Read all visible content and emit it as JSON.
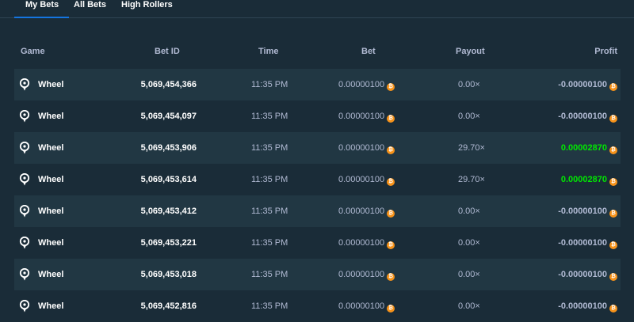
{
  "tabs": {
    "my_bets": "My Bets",
    "all_bets": "All Bets",
    "high_rollers": "High Rollers"
  },
  "columns": {
    "game": "Game",
    "bet_id": "Bet ID",
    "time": "Time",
    "bet": "Bet",
    "payout": "Payout",
    "profit": "Profit"
  },
  "colors": {
    "background": "#1a2c38",
    "row_alt": "#213743",
    "active_tab": "#1475e1",
    "win": "#00e701",
    "coin": "#f7931a"
  },
  "rows": [
    {
      "game": "Wheel",
      "bet_id": "5,069,454,366",
      "time": "11:35 PM",
      "bet": "0.00000100",
      "payout": "0.00×",
      "profit": "-0.00000100",
      "win": false
    },
    {
      "game": "Wheel",
      "bet_id": "5,069,454,097",
      "time": "11:35 PM",
      "bet": "0.00000100",
      "payout": "0.00×",
      "profit": "-0.00000100",
      "win": false
    },
    {
      "game": "Wheel",
      "bet_id": "5,069,453,906",
      "time": "11:35 PM",
      "bet": "0.00000100",
      "payout": "29.70×",
      "profit": "0.00002870",
      "win": true
    },
    {
      "game": "Wheel",
      "bet_id": "5,069,453,614",
      "time": "11:35 PM",
      "bet": "0.00000100",
      "payout": "29.70×",
      "profit": "0.00002870",
      "win": true
    },
    {
      "game": "Wheel",
      "bet_id": "5,069,453,412",
      "time": "11:35 PM",
      "bet": "0.00000100",
      "payout": "0.00×",
      "profit": "-0.00000100",
      "win": false
    },
    {
      "game": "Wheel",
      "bet_id": "5,069,453,221",
      "time": "11:35 PM",
      "bet": "0.00000100",
      "payout": "0.00×",
      "profit": "-0.00000100",
      "win": false
    },
    {
      "game": "Wheel",
      "bet_id": "5,069,453,018",
      "time": "11:35 PM",
      "bet": "0.00000100",
      "payout": "0.00×",
      "profit": "-0.00000100",
      "win": false
    },
    {
      "game": "Wheel",
      "bet_id": "5,069,452,816",
      "time": "11:35 PM",
      "bet": "0.00000100",
      "payout": "0.00×",
      "profit": "-0.00000100",
      "win": false
    }
  ]
}
